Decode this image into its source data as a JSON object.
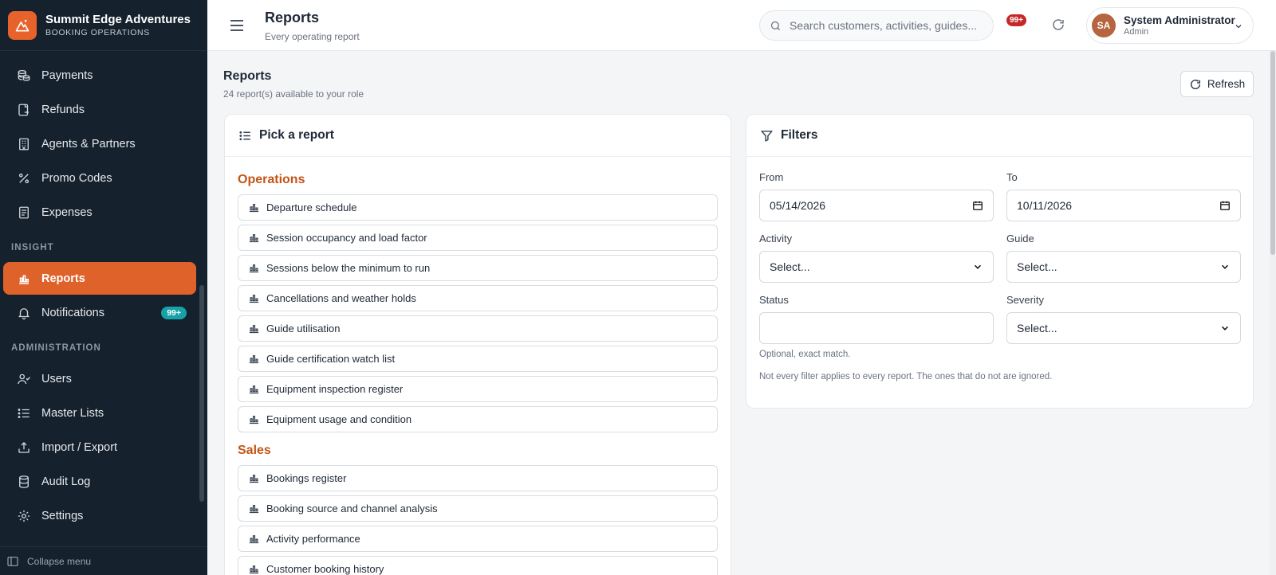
{
  "brand": {
    "name": "Summit Edge Adventures",
    "subtitle": "BOOKING OPERATIONS"
  },
  "sidebar": {
    "items_top": [
      {
        "label": "Payments",
        "icon": "coins-icon"
      },
      {
        "label": "Refunds",
        "icon": "refund-icon"
      },
      {
        "label": "Agents & Partners",
        "icon": "building-icon"
      },
      {
        "label": "Promo Codes",
        "icon": "percent-icon"
      },
      {
        "label": "Expenses",
        "icon": "receipt-icon"
      }
    ],
    "section_insight": "INSIGHT",
    "items_insight": [
      {
        "label": "Reports",
        "icon": "chart-icon",
        "active": true
      },
      {
        "label": "Notifications",
        "icon": "bell-icon",
        "badge": "99+"
      }
    ],
    "section_admin": "ADMINISTRATION",
    "items_admin": [
      {
        "label": "Users",
        "icon": "users-icon"
      },
      {
        "label": "Master Lists",
        "icon": "list-icon"
      },
      {
        "label": "Import / Export",
        "icon": "upload-icon"
      },
      {
        "label": "Audit Log",
        "icon": "database-icon"
      },
      {
        "label": "Settings",
        "icon": "gear-icon"
      }
    ],
    "collapse_label": "Collapse menu"
  },
  "header": {
    "title": "Reports",
    "subtitle": "Every operating report",
    "search_placeholder": "Search customers, activities, guides...",
    "notification_badge": "99+",
    "user": {
      "initials": "SA",
      "name": "System Administrator",
      "role": "Admin"
    }
  },
  "main": {
    "title": "Reports",
    "subtitle": "24 report(s) available to your role",
    "refresh_label": "Refresh"
  },
  "picker": {
    "heading": "Pick a report",
    "groups": [
      {
        "title": "Operations",
        "reports": [
          "Departure schedule",
          "Session occupancy and load factor",
          "Sessions below the minimum to run",
          "Cancellations and weather holds",
          "Guide utilisation",
          "Guide certification watch list",
          "Equipment inspection register",
          "Equipment usage and condition"
        ]
      },
      {
        "title": "Sales",
        "reports": [
          "Bookings register",
          "Booking source and channel analysis",
          "Activity performance",
          "Customer booking history"
        ]
      }
    ]
  },
  "filters": {
    "heading": "Filters",
    "from_label": "From",
    "from_value": "05/14/2026",
    "to_label": "To",
    "to_value": "10/11/2026",
    "activity_label": "Activity",
    "activity_value": "Select...",
    "guide_label": "Guide",
    "guide_value": "Select...",
    "status_label": "Status",
    "status_value": "",
    "status_help": "Optional, exact match.",
    "severity_label": "Severity",
    "severity_value": "Select...",
    "note": "Not every filter applies to every report. The ones that do not are ignored."
  },
  "colors": {
    "sidebar_bg": "#15212c",
    "accent": "#e0622b",
    "group_title": "#c45417",
    "badge_teal": "#17a2a8",
    "badge_red": "#c62828"
  }
}
